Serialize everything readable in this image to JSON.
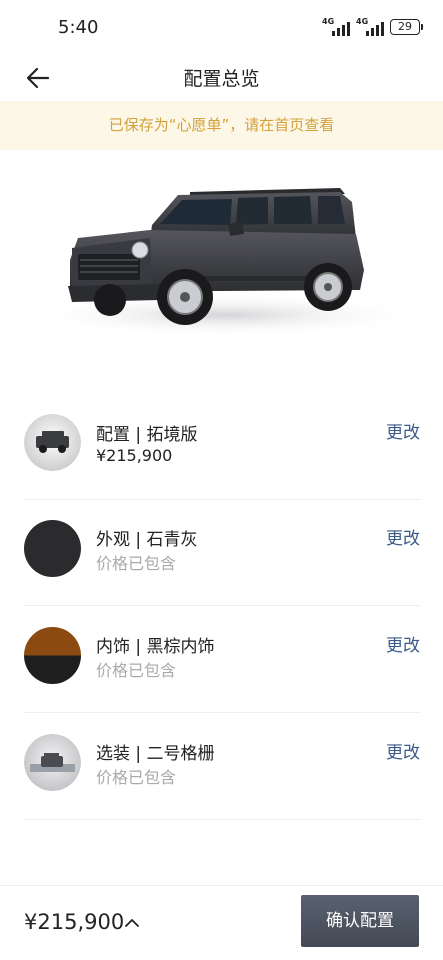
{
  "status_bar": {
    "time": "5:40",
    "signal_1": "4G",
    "signal_2": "4G",
    "battery": "29"
  },
  "header": {
    "title": "配置总览"
  },
  "notice": {
    "text": "已保存为“心愿单”，请在首页查看"
  },
  "hero": {
    "vehicle_color": "#3c3d42"
  },
  "items": [
    {
      "title": "配置 | 拓境版",
      "subtitle": "¥215,900",
      "action": "更改"
    },
    {
      "title": "外观 | 石青灰",
      "subtitle": "价格已包含",
      "action": "更改"
    },
    {
      "title": "内饰 | 黑棕内饰",
      "subtitle": "价格已包含",
      "action": "更改"
    },
    {
      "title": "选装 | 二号格栅",
      "subtitle": "价格已包含",
      "action": "更改"
    }
  ],
  "bottom_bar": {
    "total_price": "¥215,900",
    "confirm_label": "确认配置"
  },
  "colors": {
    "accent_notice": "#d3a13c",
    "link": "#3a5a8a",
    "exterior_swatch": "#2b2b2d",
    "interior_top": "#8a4a10",
    "interior_bottom": "#1e1e1e"
  }
}
